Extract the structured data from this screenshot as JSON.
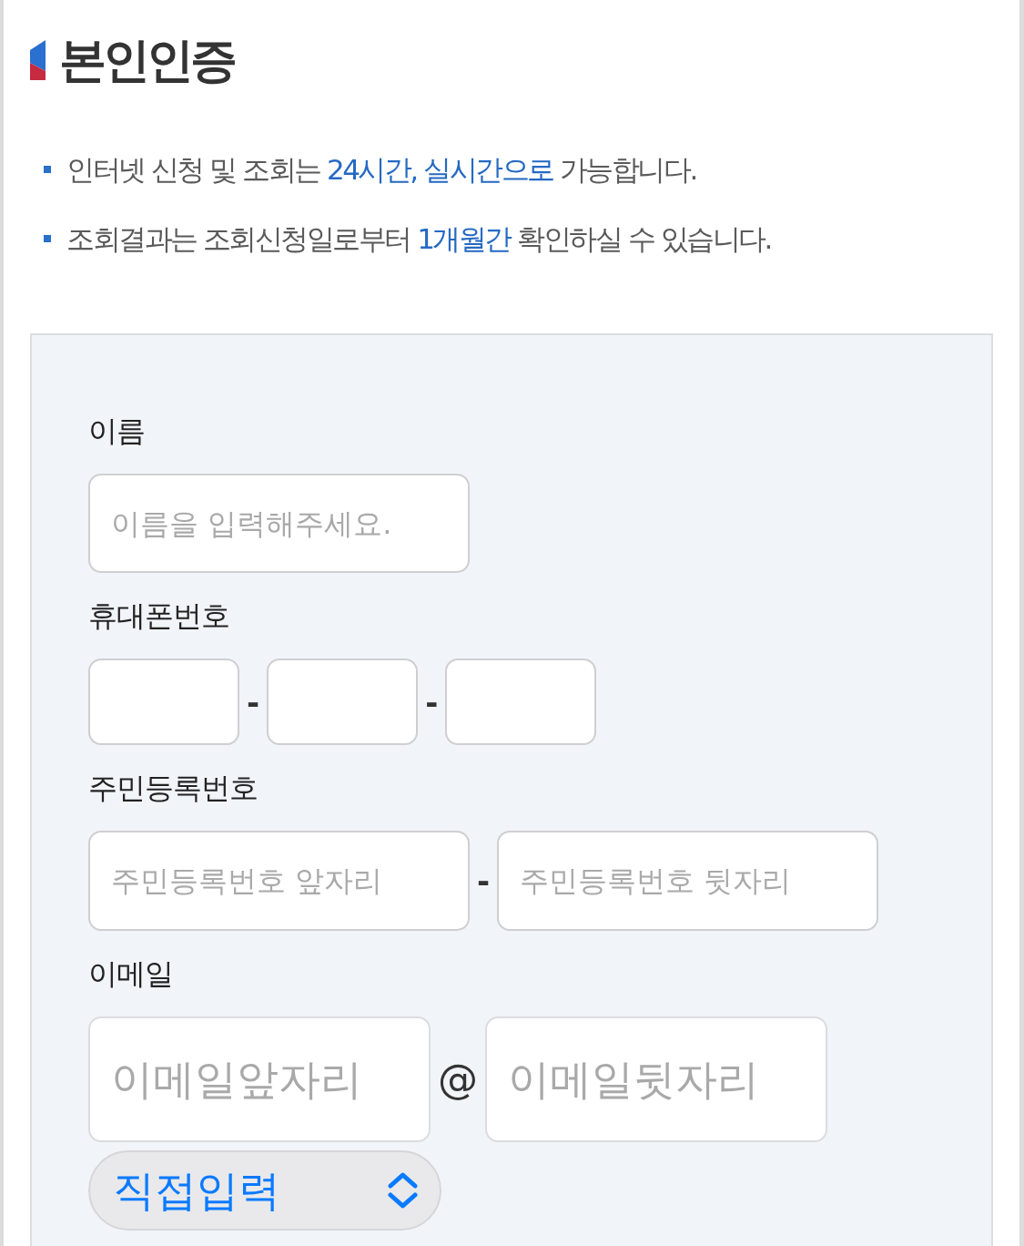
{
  "title": "본인인증",
  "notices": [
    {
      "segments": [
        {
          "text": "인터넷 신청 및 조회는 ",
          "highlight": false
        },
        {
          "text": "24시간, 실시간으로",
          "highlight": true
        },
        {
          "text": " 가능합니다.",
          "highlight": false
        }
      ]
    },
    {
      "segments": [
        {
          "text": "조회결과는 조회신청일로부터 ",
          "highlight": false
        },
        {
          "text": "1개월간",
          "highlight": true
        },
        {
          "text": " 확인하실 수 있습니다.",
          "highlight": false
        }
      ]
    }
  ],
  "form": {
    "fields": [
      {
        "kind": "name",
        "label": "이름",
        "parts": [
          {
            "kind": "input",
            "placeholder": "이름을 입력해주세요."
          }
        ]
      },
      {
        "kind": "phone",
        "label": "휴대폰번호",
        "parts": [
          {
            "kind": "input"
          },
          {
            "kind": "dash",
            "text": "-"
          },
          {
            "kind": "input"
          },
          {
            "kind": "dash",
            "text": "-"
          },
          {
            "kind": "input"
          }
        ]
      },
      {
        "kind": "rrn",
        "label": "주민등록번호",
        "parts": [
          {
            "kind": "input",
            "placeholder": "주민등록번호 앞자리"
          },
          {
            "kind": "dash",
            "text": "-"
          },
          {
            "kind": "input",
            "placeholder": "주민등록번호 뒷자리"
          }
        ]
      },
      {
        "kind": "email",
        "label": "이메일",
        "parts": [
          {
            "kind": "input",
            "placeholder": "이메일앞자리"
          },
          {
            "kind": "at",
            "text": "@"
          },
          {
            "kind": "input",
            "placeholder": "이메일뒷자리"
          }
        ],
        "select": {
          "value": "직접입력"
        }
      }
    ]
  }
}
